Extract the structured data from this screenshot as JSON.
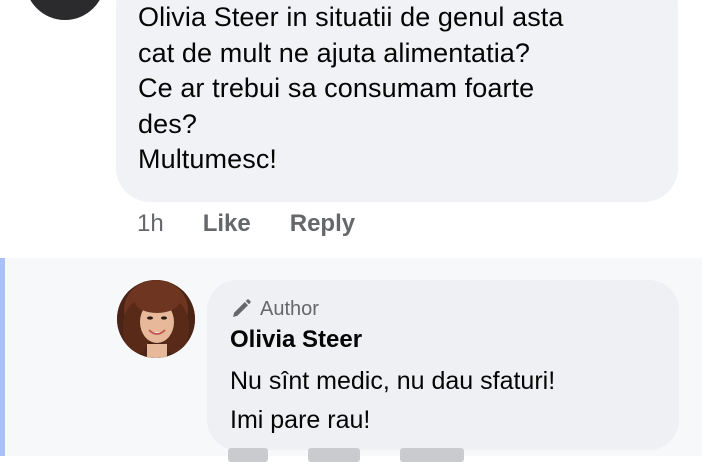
{
  "comment": {
    "lines": [
      "Olivia Steer in situatii de genul asta",
      "cat de mult ne ajuta alimentatia?",
      "Ce ar trebui sa consumam foarte",
      "des?",
      "Multumesc!"
    ],
    "time": "1h",
    "like_label": "Like",
    "reply_label": "Reply"
  },
  "reply": {
    "badge_label": "Author",
    "badge_icon": "pencil-icon",
    "author_name": "Olivia Steer",
    "lines": [
      "Nu sînt medic, nu dau sfaturi!",
      "Imi pare rau!"
    ]
  },
  "colors": {
    "bubble": "#f0f2f5",
    "secondary_text": "#65676b",
    "thread_line": "#a9c1f6"
  }
}
